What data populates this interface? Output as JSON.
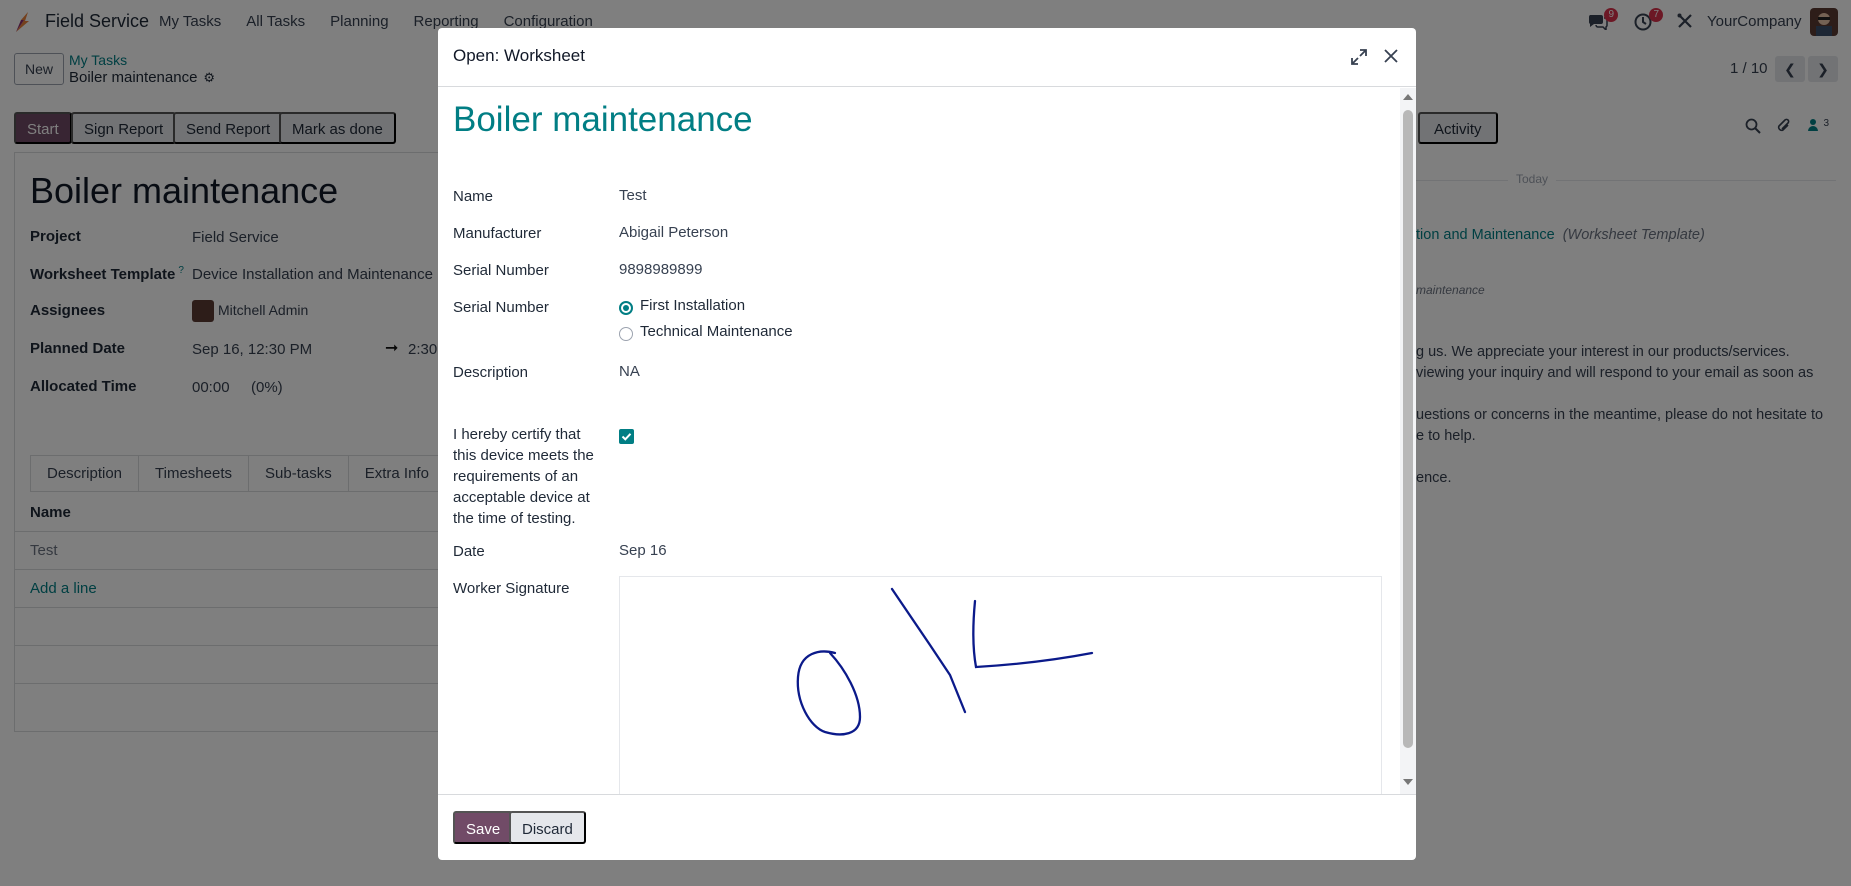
{
  "navbar": {
    "app_name": "Field Service",
    "menu": [
      "My Tasks",
      "All Tasks",
      "Planning",
      "Reporting",
      "Configuration"
    ],
    "messages_badge": "9",
    "activities_badge": "7",
    "company": "YourCompany"
  },
  "control_panel": {
    "new_label": "New",
    "breadcrumb_parent": "My Tasks",
    "breadcrumb_current": "Boiler maintenance",
    "pager_value": "1 / 10"
  },
  "statusbar": {
    "start": "Start",
    "sign_report": "Sign Report",
    "send_report": "Send Report",
    "mark_done": "Mark as done"
  },
  "task_form": {
    "title": "Boiler maintenance",
    "fields": [
      {
        "label": "Project",
        "value": "Field Service"
      },
      {
        "label": "Worksheet Template",
        "value": "Device Installation and Maintenance"
      },
      {
        "label": "Assignees",
        "value": "Mitchell Admin"
      },
      {
        "label": "Planned Date",
        "value": "Sep 16, 12:30 PM",
        "end": "2:30"
      },
      {
        "label": "Allocated Time",
        "value": "00:00",
        "percent": "(0%)"
      }
    ],
    "worksheet_help": "?",
    "tabs": [
      "Description",
      "Timesheets",
      "Sub-tasks",
      "Extra Info"
    ],
    "table_header": "Name",
    "rows": [
      "Test"
    ],
    "add_line": "Add a line"
  },
  "chatter": {
    "activity_label": "Activity",
    "followers_count": "3",
    "today": "Today",
    "lines": [
      {
        "text": "tion and Maintenance",
        "suffix": "(Worksheet Template)"
      },
      {
        "text": "maintenance"
      },
      {
        "text": "g us. We appreciate your interest in our products/services."
      },
      {
        "text": "viewing your inquiry and will respond to your email as soon as"
      },
      {
        "text": "uestions or concerns in the meantime, please do not hesitate to"
      },
      {
        "text": "e to help."
      },
      {
        "text": "ence."
      }
    ]
  },
  "modal": {
    "title": "Open: Worksheet",
    "heading": "Boiler maintenance",
    "fields": {
      "name_label": "Name",
      "name_value": "Test",
      "manufacturer_label": "Manufacturer",
      "manufacturer_value": "Abigail Peterson",
      "serial_label": "Serial Number",
      "serial_value": "9898989899",
      "serial2_label": "Serial Number",
      "radio_options": [
        "First Installation",
        "Technical Maintenance"
      ],
      "radio_selected": "First Installation",
      "description_label": "Description",
      "description_value": "NA",
      "certify_label": "I hereby certify that this device meets the requirements of an acceptable device at the time of testing.",
      "certify_checked": true,
      "date_label": "Date",
      "date_value": "Sep 16",
      "signature_label": "Worker Signature"
    },
    "save_label": "Save",
    "discard_label": "Discard"
  },
  "colors": {
    "brand": "#714b67",
    "accent": "#017e84",
    "badge": "#d9314b",
    "signature_ink": "#0b1a8a"
  }
}
